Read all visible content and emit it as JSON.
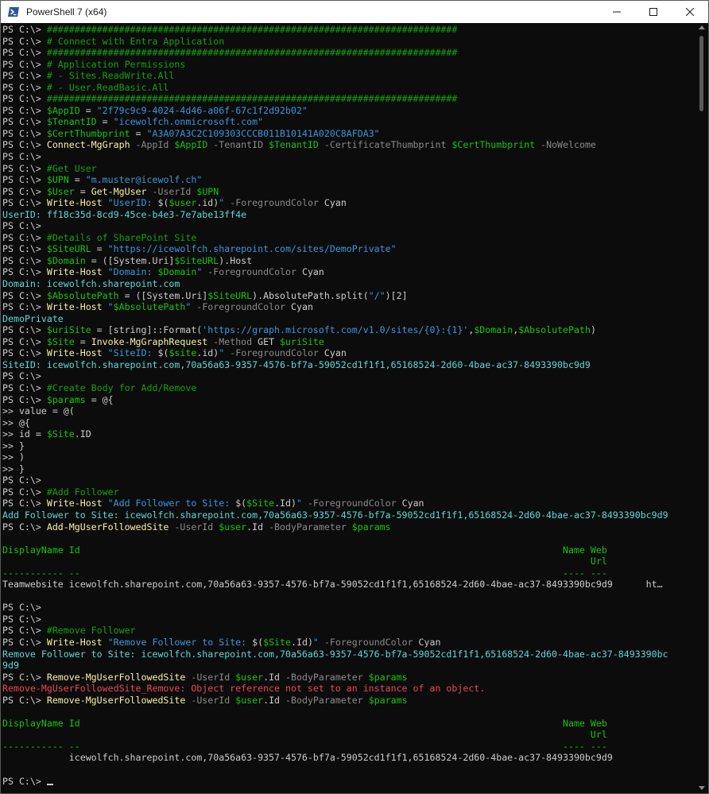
{
  "window": {
    "title": "PowerShell 7 (x64)",
    "minimize": "minimize",
    "maximize": "maximize",
    "close": "close"
  },
  "colors": {
    "background": "#0c0c0c",
    "foreground": "#cccccc",
    "comment": "#13a10e",
    "variable": "#16c60c",
    "string": "#3a96dd",
    "command": "#f9f1a5",
    "parameter": "#8a8a8a",
    "output_cyan": "#61d6d6",
    "error": "#e74856"
  },
  "lines": [
    [
      [
        "fg",
        "PS C:\\> "
      ],
      [
        "cmt",
        "##########################################################################"
      ]
    ],
    [
      [
        "fg",
        "PS C:\\> "
      ],
      [
        "cmt",
        "# Connect with Entra Application"
      ]
    ],
    [
      [
        "fg",
        "PS C:\\> "
      ],
      [
        "cmt",
        "##########################################################################"
      ]
    ],
    [
      [
        "fg",
        "PS C:\\> "
      ],
      [
        "cmt",
        "# Application Permissions"
      ]
    ],
    [
      [
        "fg",
        "PS C:\\> "
      ],
      [
        "cmt",
        "# - Sites.ReadWrite.All"
      ]
    ],
    [
      [
        "fg",
        "PS C:\\> "
      ],
      [
        "cmt",
        "# - User.ReadBasic.All"
      ]
    ],
    [
      [
        "fg",
        "PS C:\\> "
      ],
      [
        "cmt",
        "##########################################################################"
      ]
    ],
    [
      [
        "fg",
        "PS C:\\> "
      ],
      [
        "var",
        "$AppID"
      ],
      [
        "fg",
        " = "
      ],
      [
        "str",
        "\"2f79c9c9-4024-4d46-a06f-67c1f2d92b02\""
      ]
    ],
    [
      [
        "fg",
        "PS C:\\> "
      ],
      [
        "var",
        "$TenantID"
      ],
      [
        "fg",
        " = "
      ],
      [
        "str",
        "\"icewolfch.onmicrosoft.com\""
      ]
    ],
    [
      [
        "fg",
        "PS C:\\> "
      ],
      [
        "var",
        "$CertThumbprint"
      ],
      [
        "fg",
        " = "
      ],
      [
        "str",
        "\"A3A07A3C2C109303CCCB011B10141A020C8AFDA3\""
      ]
    ],
    [
      [
        "fg",
        "PS C:\\> "
      ],
      [
        "cmd",
        "Connect-MgGraph"
      ],
      [
        "prm",
        " -AppId "
      ],
      [
        "var",
        "$AppID"
      ],
      [
        "prm",
        " -TenantID "
      ],
      [
        "var",
        "$TenantID"
      ],
      [
        "prm",
        " -CertificateThumbprint "
      ],
      [
        "var",
        "$CertThumbprint"
      ],
      [
        "prm",
        " -NoWelcome"
      ]
    ],
    [
      [
        "fg",
        "PS C:\\>"
      ]
    ],
    [
      [
        "fg",
        "PS C:\\> "
      ],
      [
        "cmt",
        "#Get User"
      ]
    ],
    [
      [
        "fg",
        "PS C:\\> "
      ],
      [
        "var",
        "$UPN"
      ],
      [
        "fg",
        " = "
      ],
      [
        "str",
        "\"m.muster@icewolf.ch\""
      ]
    ],
    [
      [
        "fg",
        "PS C:\\> "
      ],
      [
        "var",
        "$User"
      ],
      [
        "fg",
        " = "
      ],
      [
        "cmd",
        "Get-MgUser"
      ],
      [
        "prm",
        " -UserId "
      ],
      [
        "var",
        "$UPN"
      ]
    ],
    [
      [
        "fg",
        "PS C:\\> "
      ],
      [
        "cmd",
        "Write-Host"
      ],
      [
        "str",
        " \"UserID: "
      ],
      [
        "fg",
        "$("
      ],
      [
        "var",
        "$user"
      ],
      [
        "fg",
        ".id)"
      ],
      [
        "str",
        "\""
      ],
      [
        "prm",
        " -ForegroundColor "
      ],
      [
        "fg",
        "Cyan"
      ]
    ],
    [
      [
        "out",
        "UserID: ff18c35d-8cd9-45ce-b4e3-7e7abe13ff4e"
      ]
    ],
    [
      [
        "fg",
        "PS C:\\>"
      ]
    ],
    [
      [
        "fg",
        "PS C:\\> "
      ],
      [
        "cmt",
        "#Details of SharePoint Site"
      ]
    ],
    [
      [
        "fg",
        "PS C:\\> "
      ],
      [
        "var",
        "$SiteURL"
      ],
      [
        "fg",
        " = "
      ],
      [
        "str",
        "\"https://icewolfch.sharepoint.com/sites/DemoPrivate\""
      ]
    ],
    [
      [
        "fg",
        "PS C:\\> "
      ],
      [
        "var",
        "$Domain"
      ],
      [
        "fg",
        " = ([System.Uri]"
      ],
      [
        "var",
        "$SiteURL"
      ],
      [
        "fg",
        ").Host"
      ]
    ],
    [
      [
        "fg",
        "PS C:\\> "
      ],
      [
        "cmd",
        "Write-Host"
      ],
      [
        "str",
        " \"Domain: "
      ],
      [
        "var",
        "$Domain"
      ],
      [
        "str",
        "\""
      ],
      [
        "prm",
        " -ForegroundColor "
      ],
      [
        "fg",
        "Cyan"
      ]
    ],
    [
      [
        "out",
        "Domain: icewolfch.sharepoint.com"
      ]
    ],
    [
      [
        "fg",
        "PS C:\\> "
      ],
      [
        "var",
        "$AbsolutePath"
      ],
      [
        "fg",
        " = ([System.Uri]"
      ],
      [
        "var",
        "$SiteURL"
      ],
      [
        "fg",
        ").AbsolutePath.split("
      ],
      [
        "str",
        "\"/\""
      ],
      [
        "fg",
        ")[2]"
      ]
    ],
    [
      [
        "fg",
        "PS C:\\> "
      ],
      [
        "cmd",
        "Write-Host"
      ],
      [
        "str",
        " \""
      ],
      [
        "var",
        "$AbsolutePath"
      ],
      [
        "str",
        "\""
      ],
      [
        "prm",
        " -ForegroundColor "
      ],
      [
        "fg",
        "Cyan"
      ]
    ],
    [
      [
        "out",
        "DemoPrivate"
      ]
    ],
    [
      [
        "fg",
        "PS C:\\> "
      ],
      [
        "var",
        "$uriSite"
      ],
      [
        "fg",
        " = [string]::Format("
      ],
      [
        "str",
        "'https://graph.microsoft.com/v1.0/sites/{0}:{1}'"
      ],
      [
        "fg",
        ","
      ],
      [
        "var",
        "$Domain"
      ],
      [
        "fg",
        ","
      ],
      [
        "var",
        "$AbsolutePath"
      ],
      [
        "fg",
        ")"
      ]
    ],
    [
      [
        "fg",
        "PS C:\\> "
      ],
      [
        "var",
        "$Site"
      ],
      [
        "fg",
        " = "
      ],
      [
        "cmd",
        "Invoke-MgGraphRequest"
      ],
      [
        "prm",
        " -Method "
      ],
      [
        "fg",
        "GET "
      ],
      [
        "var",
        "$uriSite"
      ]
    ],
    [
      [
        "fg",
        "PS C:\\> "
      ],
      [
        "cmd",
        "Write-Host"
      ],
      [
        "str",
        " \"SiteID: "
      ],
      [
        "fg",
        "$("
      ],
      [
        "var",
        "$site"
      ],
      [
        "fg",
        ".id)"
      ],
      [
        "str",
        "\""
      ],
      [
        "prm",
        " -ForegroundColor "
      ],
      [
        "fg",
        "Cyan"
      ]
    ],
    [
      [
        "out",
        "SiteID: icewolfch.sharepoint.com,70a56a63-9357-4576-bf7a-59052cd1f1f1,65168524-2d60-4bae-ac37-8493390bc9d9"
      ]
    ],
    [
      [
        "fg",
        "PS C:\\>"
      ]
    ],
    [
      [
        "fg",
        "PS C:\\> "
      ],
      [
        "cmt",
        "#Create Body for Add/Remove"
      ]
    ],
    [
      [
        "fg",
        "PS C:\\> "
      ],
      [
        "var",
        "$params"
      ],
      [
        "fg",
        " = @{"
      ]
    ],
    [
      [
        "fg",
        ">> value = @("
      ]
    ],
    [
      [
        "fg",
        ">> @{"
      ]
    ],
    [
      [
        "fg",
        ">> id = "
      ],
      [
        "var",
        "$Site"
      ],
      [
        "fg",
        ".ID"
      ]
    ],
    [
      [
        "fg",
        ">> }"
      ]
    ],
    [
      [
        "fg",
        ">> )"
      ]
    ],
    [
      [
        "fg",
        ">> }"
      ]
    ],
    [
      [
        "fg",
        "PS C:\\>"
      ]
    ],
    [
      [
        "fg",
        "PS C:\\> "
      ],
      [
        "cmt",
        "#Add Follower"
      ]
    ],
    [
      [
        "fg",
        "PS C:\\> "
      ],
      [
        "cmd",
        "Write-Host"
      ],
      [
        "str",
        " \"Add Follower to Site: "
      ],
      [
        "fg",
        "$("
      ],
      [
        "var",
        "$Site"
      ],
      [
        "fg",
        ".Id)"
      ],
      [
        "str",
        "\""
      ],
      [
        "prm",
        " -ForegroundColor "
      ],
      [
        "fg",
        "Cyan"
      ]
    ],
    [
      [
        "out",
        "Add Follower to Site: icewolfch.sharepoint.com,70a56a63-9357-4576-bf7a-59052cd1f1f1,65168524-2d60-4bae-ac37-8493390bc9d9"
      ]
    ],
    [
      [
        "fg",
        "PS C:\\> "
      ],
      [
        "cmd",
        "Add-MgUserFollowedSite"
      ],
      [
        "prm",
        " -UserId "
      ],
      [
        "var",
        "$user"
      ],
      [
        "fg",
        ".Id"
      ],
      [
        "prm",
        " -BodyParameter "
      ],
      [
        "var",
        "$params"
      ]
    ],
    [
      [
        "fg",
        ""
      ]
    ],
    [
      [
        "hdr",
        "DisplayName Id                                                                                       Name Web"
      ]
    ],
    [
      [
        "hdr",
        "                                                                                                          Url"
      ]
    ],
    [
      [
        "hdr",
        "----------- --                                                                                       ---- ---"
      ]
    ],
    [
      [
        "fg",
        "Teamwebsite icewolfch.sharepoint.com,70a56a63-9357-4576-bf7a-59052cd1f1f1,65168524-2d60-4bae-ac37-8493390bc9d9      ht…"
      ]
    ],
    [
      [
        "fg",
        ""
      ]
    ],
    [
      [
        "fg",
        "PS C:\\>"
      ]
    ],
    [
      [
        "fg",
        "PS C:\\>"
      ]
    ],
    [
      [
        "fg",
        "PS C:\\> "
      ],
      [
        "cmt",
        "#Remove Follower"
      ]
    ],
    [
      [
        "fg",
        "PS C:\\> "
      ],
      [
        "cmd",
        "Write-Host"
      ],
      [
        "str",
        " \"Remove Follower to Site: "
      ],
      [
        "fg",
        "$("
      ],
      [
        "var",
        "$Site"
      ],
      [
        "fg",
        ".Id)"
      ],
      [
        "str",
        "\""
      ],
      [
        "prm",
        " -ForegroundColor "
      ],
      [
        "fg",
        "Cyan"
      ]
    ],
    [
      [
        "out",
        "Remove Follower to Site: icewolfch.sharepoint.com,70a56a63-9357-4576-bf7a-59052cd1f1f1,65168524-2d60-4bae-ac37-8493390bc"
      ]
    ],
    [
      [
        "out",
        "9d9"
      ]
    ],
    [
      [
        "fg",
        "PS C:\\> "
      ],
      [
        "cmd",
        "Remove-MgUserFollowedSite"
      ],
      [
        "prm",
        " -UserId "
      ],
      [
        "var",
        "$user"
      ],
      [
        "fg",
        ".Id"
      ],
      [
        "prm",
        " -BodyParameter "
      ],
      [
        "var",
        "$params"
      ]
    ],
    [
      [
        "red",
        "Remove-MgUserFollowedSite_Remove: Object reference not set to an instance of an object."
      ]
    ],
    [
      [
        "fg",
        "PS C:\\> "
      ],
      [
        "cmd",
        "Remove-MgUserFollowedSite"
      ],
      [
        "prm",
        " -UserId "
      ],
      [
        "var",
        "$user"
      ],
      [
        "fg",
        ".Id"
      ],
      [
        "prm",
        " -BodyParameter "
      ],
      [
        "var",
        "$params"
      ]
    ],
    [
      [
        "fg",
        ""
      ]
    ],
    [
      [
        "hdr",
        "DisplayName Id                                                                                       Name Web"
      ]
    ],
    [
      [
        "hdr",
        "                                                                                                          Url"
      ]
    ],
    [
      [
        "hdr",
        "----------- --                                                                                       ---- ---"
      ]
    ],
    [
      [
        "fg",
        "            icewolfch.sharepoint.com,70a56a63-9357-4576-bf7a-59052cd1f1f1,65168524-2d60-4bae-ac37-8493390bc9d9"
      ]
    ],
    [
      [
        "fg",
        ""
      ]
    ],
    [
      [
        "fg",
        "PS C:\\> "
      ],
      [
        "cursor",
        ""
      ]
    ]
  ]
}
